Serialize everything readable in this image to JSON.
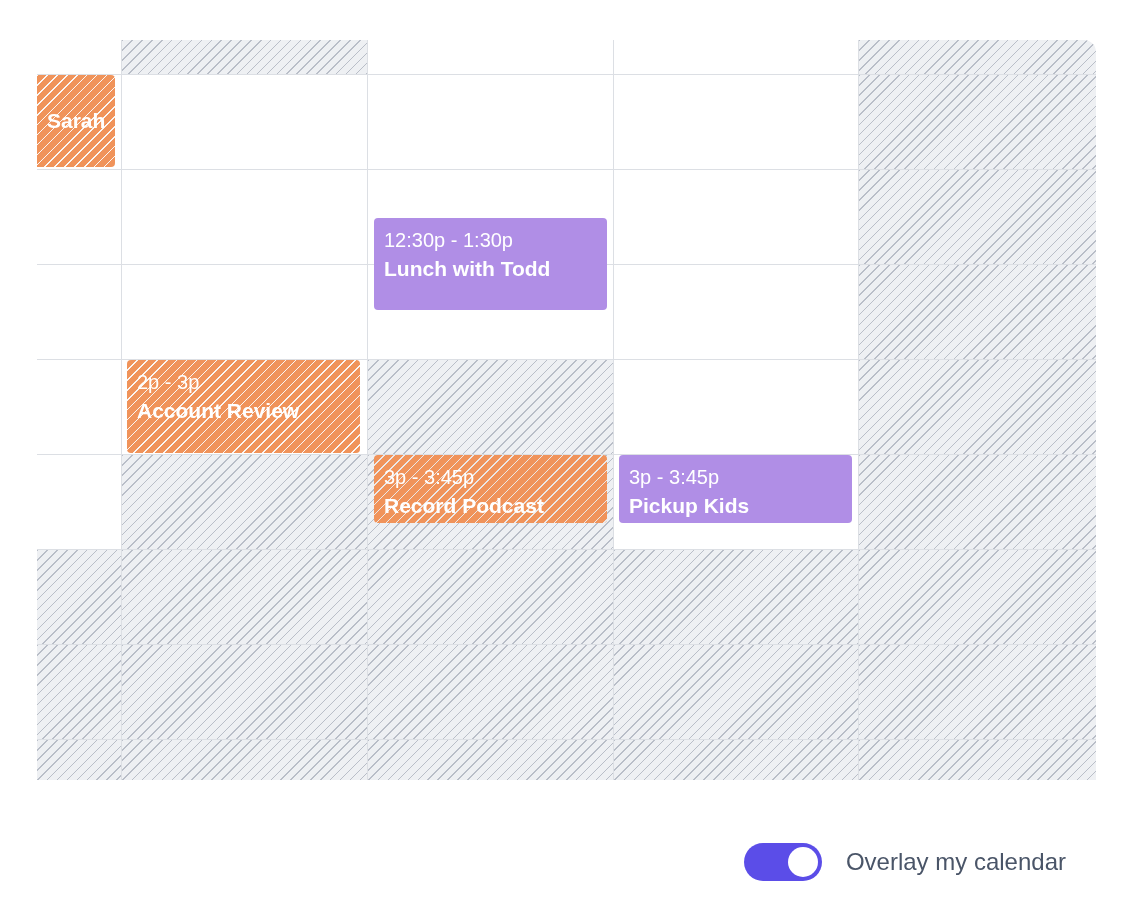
{
  "calendar": {
    "columns": [
      {
        "slots": [
          {
            "unavailable": false
          },
          {
            "unavailable": false
          },
          {
            "unavailable": false
          },
          {
            "unavailable": false
          },
          {
            "unavailable": false
          },
          {
            "unavailable": false
          },
          {
            "unavailable": true
          },
          {
            "unavailable": true
          },
          {
            "unavailable": true
          }
        ],
        "events": [
          {
            "kind": "overlay",
            "color": "#f0935a",
            "title": "Sarah"
          }
        ]
      },
      {
        "slots": [
          {
            "unavailable": true
          },
          {
            "unavailable": false
          },
          {
            "unavailable": false
          },
          {
            "unavailable": false
          },
          {
            "unavailable": false
          },
          {
            "unavailable": true
          },
          {
            "unavailable": true
          },
          {
            "unavailable": true
          },
          {
            "unavailable": true
          }
        ],
        "events": [
          {
            "kind": "overlay",
            "color": "#f0935a",
            "time": "2p - 3p",
            "title": "Account Review"
          }
        ]
      },
      {
        "slots": [
          {
            "unavailable": false
          },
          {
            "unavailable": false
          },
          {
            "unavailable": false
          },
          {
            "unavailable": false
          },
          {
            "unavailable": true
          },
          {
            "unavailable": true
          },
          {
            "unavailable": true
          },
          {
            "unavailable": true
          },
          {
            "unavailable": true
          }
        ],
        "events": [
          {
            "kind": "event",
            "color": "#b08ee6",
            "time": "12:30p - 1:30p",
            "title": "Lunch with Todd"
          },
          {
            "kind": "overlay",
            "color": "#f0935a",
            "time": "3p - 3:45p",
            "title": "Record Podcast"
          }
        ]
      },
      {
        "slots": [
          {
            "unavailable": false
          },
          {
            "unavailable": false
          },
          {
            "unavailable": false
          },
          {
            "unavailable": false
          },
          {
            "unavailable": false
          },
          {
            "unavailable": false
          },
          {
            "unavailable": true
          },
          {
            "unavailable": true
          },
          {
            "unavailable": true
          }
        ],
        "events": [
          {
            "kind": "event",
            "color": "#b08ee6",
            "time": "3p - 3:45p",
            "title": "Pickup Kids"
          }
        ]
      },
      {
        "slots": [
          {
            "unavailable": true
          },
          {
            "unavailable": true
          },
          {
            "unavailable": true
          },
          {
            "unavailable": true
          },
          {
            "unavailable": true
          },
          {
            "unavailable": true
          },
          {
            "unavailable": true
          },
          {
            "unavailable": true
          },
          {
            "unavailable": true
          }
        ]
      }
    ]
  },
  "overlay_toggle": {
    "on": true,
    "label": "Overlay my calendar"
  }
}
